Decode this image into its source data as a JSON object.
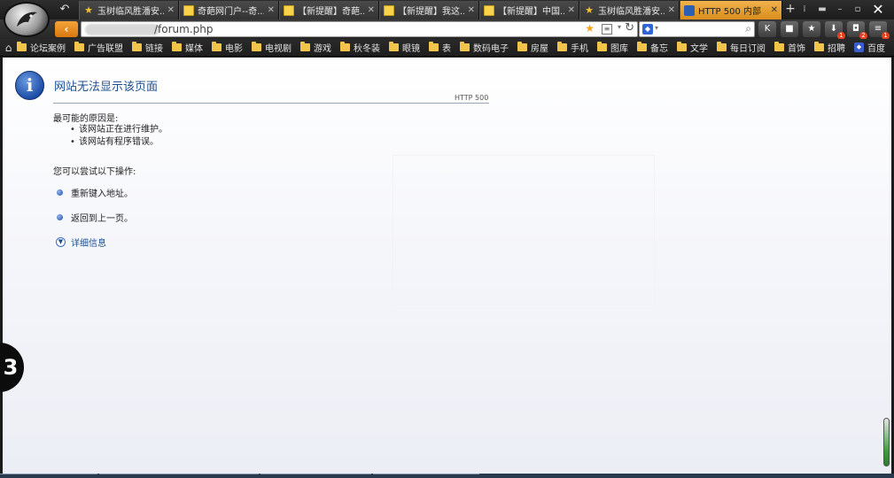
{
  "tabs": [
    {
      "favicon": "star-icon",
      "title": "玉树临风胜潘安..."
    },
    {
      "favicon": "page-icon",
      "title": "奇葩网门户--奇..."
    },
    {
      "favicon": "page-icon",
      "title": "【新提醒】奇葩..."
    },
    {
      "favicon": "page-icon",
      "title": "【新提醒】我这..."
    },
    {
      "favicon": "page-icon",
      "title": "【新提醒】中国..."
    },
    {
      "favicon": "star-icon",
      "title": "玉树临风胜潘安..."
    },
    {
      "favicon": "qihoo-icon",
      "title": "HTTP  500 内部",
      "active": true
    }
  ],
  "address_bar": {
    "url": "/forum.php"
  },
  "toolbar_badges": {
    "download": "1",
    "games": "2",
    "menu": "1"
  },
  "bookmarks": [
    "论坛案例",
    "广告联盟",
    "链接",
    "媒体",
    "电影",
    "电视剧",
    "游戏",
    "秋冬装",
    "眼镜",
    "表",
    "数码电子",
    "房屋",
    "手机",
    "图库",
    "备忘",
    "文学",
    "每日订阅",
    "首饰",
    "招聘",
    "百度"
  ],
  "error_page": {
    "title": "网站无法显示该页面",
    "code": "HTTP 500",
    "causes_heading": "最可能的原因是:",
    "causes": [
      "该网站正在进行维护。",
      "该网站有程序错误。"
    ],
    "actions_heading": "您可以尝试以下操作:",
    "actions": [
      "重新键入地址。",
      "返回到上一页。"
    ],
    "more_info": "详细信息"
  },
  "side_widget": {
    "label": "3"
  },
  "colors": {
    "active_tab": "#e89f2f",
    "chrome_dark": "#262626",
    "error_title": "#1f4f8f",
    "back_button": "#e88a1c"
  }
}
